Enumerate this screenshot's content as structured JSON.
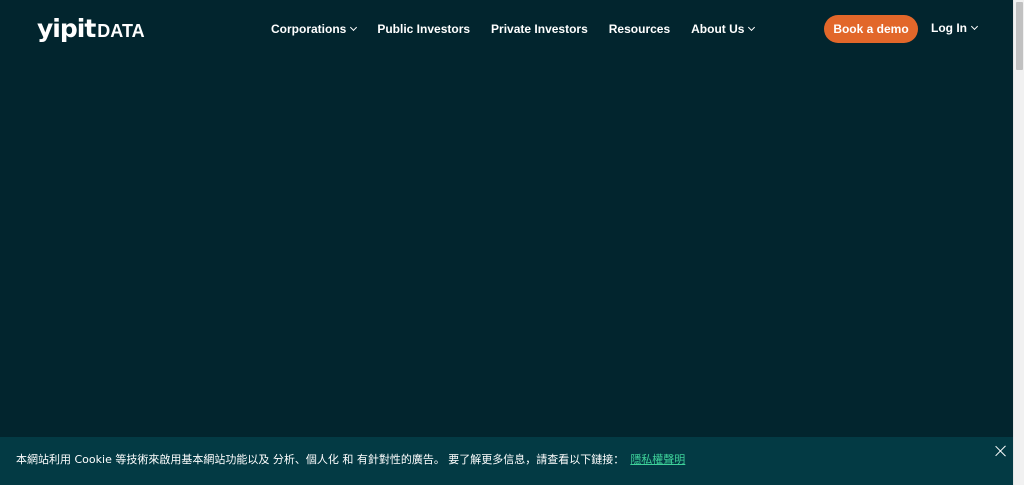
{
  "header": {
    "logo": {
      "part1": "yipit",
      "part2": "DATA"
    },
    "nav": [
      {
        "label": "Corporations",
        "has_dropdown": true
      },
      {
        "label": "Public Investors",
        "has_dropdown": false
      },
      {
        "label": "Private Investors",
        "has_dropdown": false
      },
      {
        "label": "Resources",
        "has_dropdown": false
      },
      {
        "label": "About Us",
        "has_dropdown": true
      }
    ],
    "cta_label": "Book a demo",
    "login_label": "Log In"
  },
  "cookie_banner": {
    "text": "本網站利用 Cookie 等技術來啟用基本網站功能以及 分析、個人化 和 有針對性的廣告。 要了解更多信息，請查看以下鏈接：",
    "link_label": "隱私權聲明"
  },
  "colors": {
    "background": "#02252e",
    "banner": "#033a44",
    "accent": "#e2672a",
    "link": "#3ed29a"
  }
}
